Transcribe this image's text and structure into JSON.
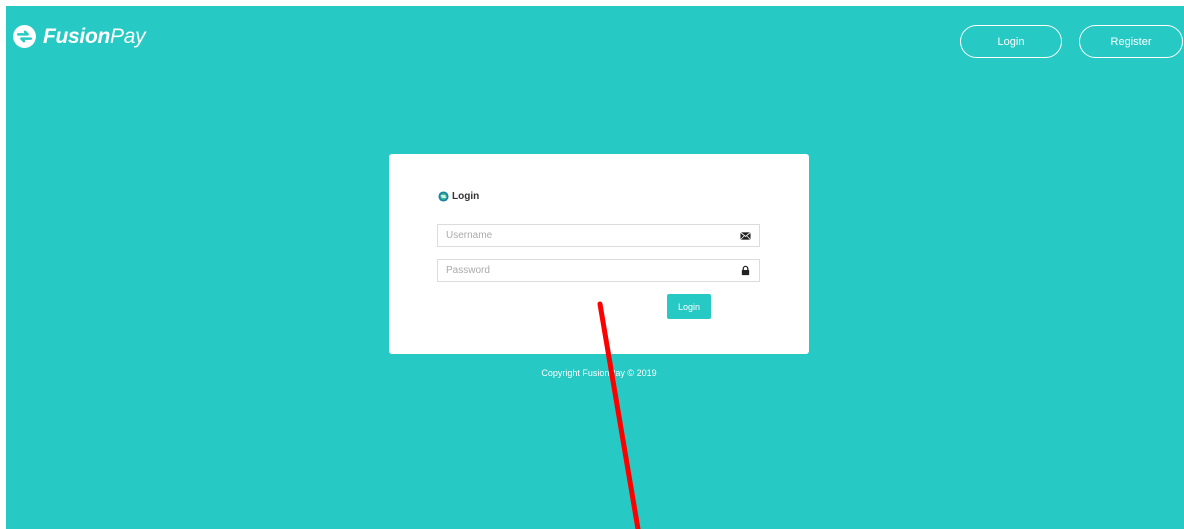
{
  "brand": {
    "bold": "Fusion",
    "light": "Pay",
    "icon": "fusionpay-logo-icon"
  },
  "header": {
    "login_label": "Login",
    "register_label": "Register"
  },
  "login_card": {
    "title": "Login",
    "title_icon": "fusionpay-logo-icon",
    "username_placeholder": "Username",
    "username_icon": "envelope-icon",
    "password_placeholder": "Password",
    "password_icon": "lock-icon",
    "submit_label": "Login"
  },
  "footer": {
    "copyright": "Copyright FusionPay © 2019"
  },
  "colors": {
    "background": "#26c9c3",
    "card": "#ffffff",
    "accent": "#26c9c3",
    "annotation": "#ff0000"
  },
  "annotation": {
    "type": "red-arrow-line"
  }
}
